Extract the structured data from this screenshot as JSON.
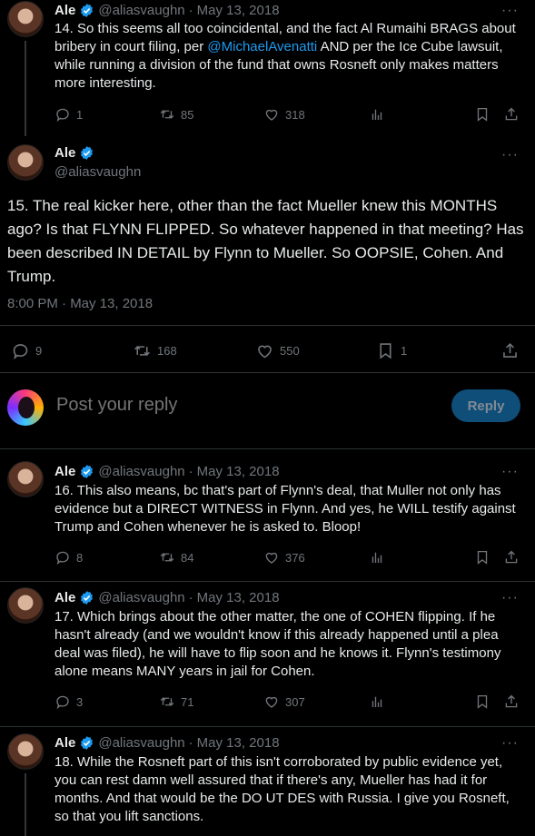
{
  "author": {
    "name": "Ale",
    "handle": "@aliasvaughn"
  },
  "tweets": [
    {
      "date": "May 13, 2018",
      "text_before": "14. So this seems all too coincidental, and the fact Al Rumaihi BRAGS about bribery in court filing, per ",
      "mention": "@MichaelAvenatti",
      "text_after": " AND per the Ice Cube lawsuit, while running a division of the fund that owns Rosneft only makes matters more interesting.",
      "replies": "1",
      "retweets": "85",
      "likes": "318"
    },
    {
      "date": "May 13, 2018",
      "text": "16. This also means, bc that's part of Flynn's deal, that Muller not only has evidence but a DIRECT WITNESS in Flynn. And yes, he WILL testify against Trump and Cohen whenever he is asked to. Bloop!",
      "replies": "8",
      "retweets": "84",
      "likes": "376"
    },
    {
      "date": "May 13, 2018",
      "text": "17. Which brings about the other matter, the one of COHEN flipping. If he hasn't already (and we wouldn't know if this already happened until a plea deal was filed), he will have to flip soon and he knows it. Flynn's testimony alone means MANY years in jail for Cohen.",
      "replies": "3",
      "retweets": "71",
      "likes": "307"
    },
    {
      "date": "May 13, 2018",
      "text": "18. While the Rosneft part of this isn't corroborated by public evidence yet, you can rest damn well assured that if there's any, Mueller has had it for months. And that would be the DO UT DES with Russia. I give you Rosneft, so that you lift sanctions."
    }
  ],
  "focused": {
    "text": "15. The real kicker here, other than the fact Mueller knew this MONTHS ago? Is that FLYNN FLIPPED. So whatever happened in that meeting? Has been described IN DETAIL by Flynn to Mueller. So OOPSIE, Cohen. And Trump.",
    "time": "8:00 PM · May 13, 2018",
    "replies": "9",
    "retweets": "168",
    "likes": "550",
    "bookmarks": "1"
  },
  "reply_box": {
    "placeholder": "Post your reply",
    "button": "Reply"
  },
  "separator": "·",
  "colors": {
    "background": "#000000",
    "text": "#e7e9ea",
    "muted": "#71767b",
    "link": "#1d9bf0",
    "verified": "#1d9bf0",
    "reply_button": "#0f4e78"
  }
}
